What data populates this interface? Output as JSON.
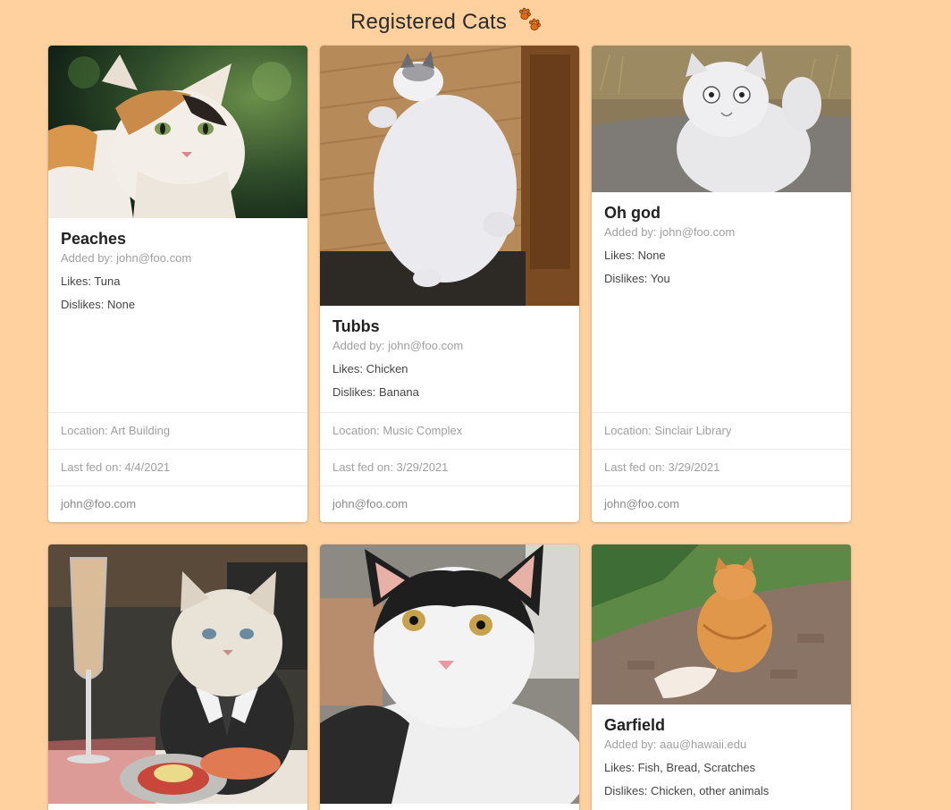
{
  "header": {
    "title": "Registered Cats",
    "icon": "paw-prints-icon",
    "icon_color": "#e06a12"
  },
  "labels": {
    "added_by": "Added by: ",
    "likes": "Likes: ",
    "dislikes": "Dislikes: ",
    "location": "Location: ",
    "last_fed": "Last fed on: "
  },
  "cards": [
    {
      "name": "Peaches",
      "added_by": "Added by: john@foo.com",
      "likes": "Likes: Tuna",
      "dislikes": "Dislikes: None",
      "location": "Location: Art Building",
      "last_fed": "Last fed on: 4/4/2021",
      "owner": "john@foo.com",
      "photo": "calico-cat-photo"
    },
    {
      "name": "Tubbs",
      "added_by": "Added by: john@foo.com",
      "likes": "Likes: Chicken",
      "dislikes": "Dislikes: Banana",
      "location": "Location: Music Complex",
      "last_fed": "Last fed on: 3/29/2021",
      "owner": "john@foo.com",
      "photo": "fluffy-white-cat-photo"
    },
    {
      "name": "Oh god",
      "added_by": "Added by: john@foo.com",
      "likes": "Likes: None",
      "dislikes": "Dislikes: You",
      "location": "Location: Sinclair Library",
      "last_fed": "Last fed on: 3/29/2021",
      "owner": "john@foo.com",
      "photo": "persian-cat-photo"
    },
    {
      "photo": "cat-in-tuxedo-photo"
    },
    {
      "photo": "black-white-kitten-photo"
    },
    {
      "name": "Garfield",
      "added_by": "Added by: aau@hawaii.edu",
      "likes": "Likes: Fish, Bread, Scratches",
      "dislikes": "Dislikes: Chicken, other animals",
      "photo": "orange-cat-photo"
    }
  ],
  "colors": {
    "background": "#ffd19f",
    "card": "#ffffff",
    "muted_text": "#a0a0a0"
  }
}
